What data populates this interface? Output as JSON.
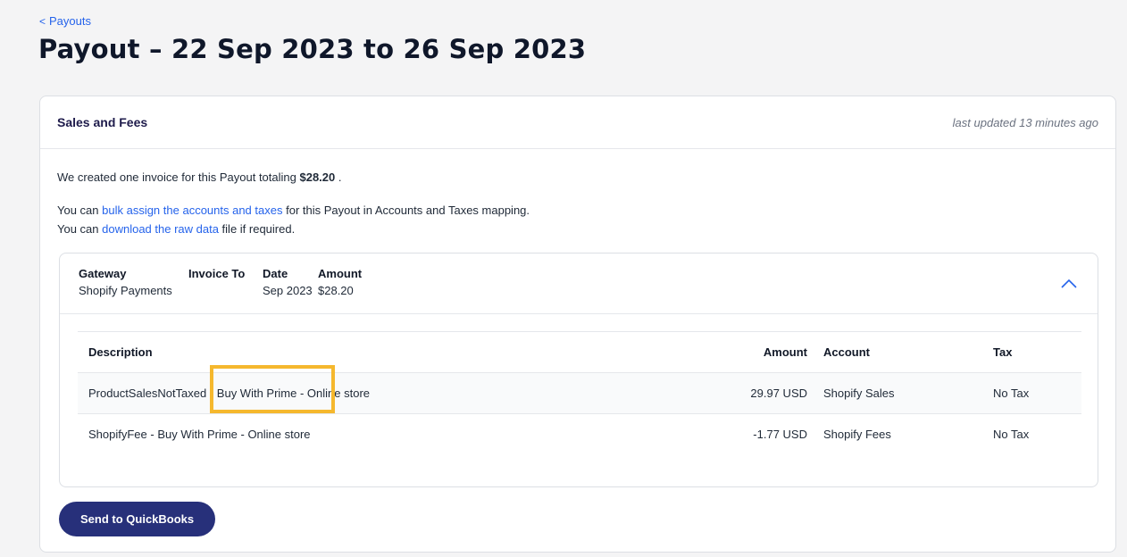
{
  "nav": {
    "back_label": "Payouts"
  },
  "page": {
    "title": "Payout – 22 Sep 2023 to 26 Sep 2023"
  },
  "card": {
    "title": "Sales and Fees",
    "last_updated": "last updated 13 minutes ago",
    "invoice_line": {
      "prefix": "We created one invoice for this Payout totaling ",
      "total": "$28.20",
      "suffix": " ."
    },
    "bulk_line": {
      "prefix": "You can ",
      "link": "bulk assign the accounts and taxes",
      "suffix": " for this Payout in Accounts and Taxes mapping."
    },
    "download_line": {
      "prefix": "You can ",
      "link": "download the raw data",
      "suffix": " file if required."
    }
  },
  "invoice": {
    "gateway_label": "Gateway",
    "gateway_value": "Shopify Payments",
    "invoice_to_label": "Invoice To",
    "invoice_to_value": "",
    "date_label": "Date",
    "date_value": "Sep 2023",
    "amount_label": "Amount",
    "amount_value": "$28.20",
    "collapse_icon": "chevron-up-icon"
  },
  "line_items": {
    "headers": {
      "description": "Description",
      "amount": "Amount",
      "account": "Account",
      "tax": "Tax"
    },
    "rows": [
      {
        "description": "ProductSalesNotTaxed - Buy With Prime - Online store",
        "amount": "29.97 USD",
        "account": "Shopify Sales",
        "tax": "No Tax"
      },
      {
        "description": "ShopifyFee - Buy With Prime - Online store",
        "amount": "-1.77 USD",
        "account": "Shopify Fees",
        "tax": "No Tax"
      }
    ]
  },
  "actions": {
    "send_label": "Send to QuickBooks"
  },
  "colors": {
    "link": "#2563eb",
    "primary_button": "#27307a",
    "highlight_box": "#f5b82e"
  }
}
